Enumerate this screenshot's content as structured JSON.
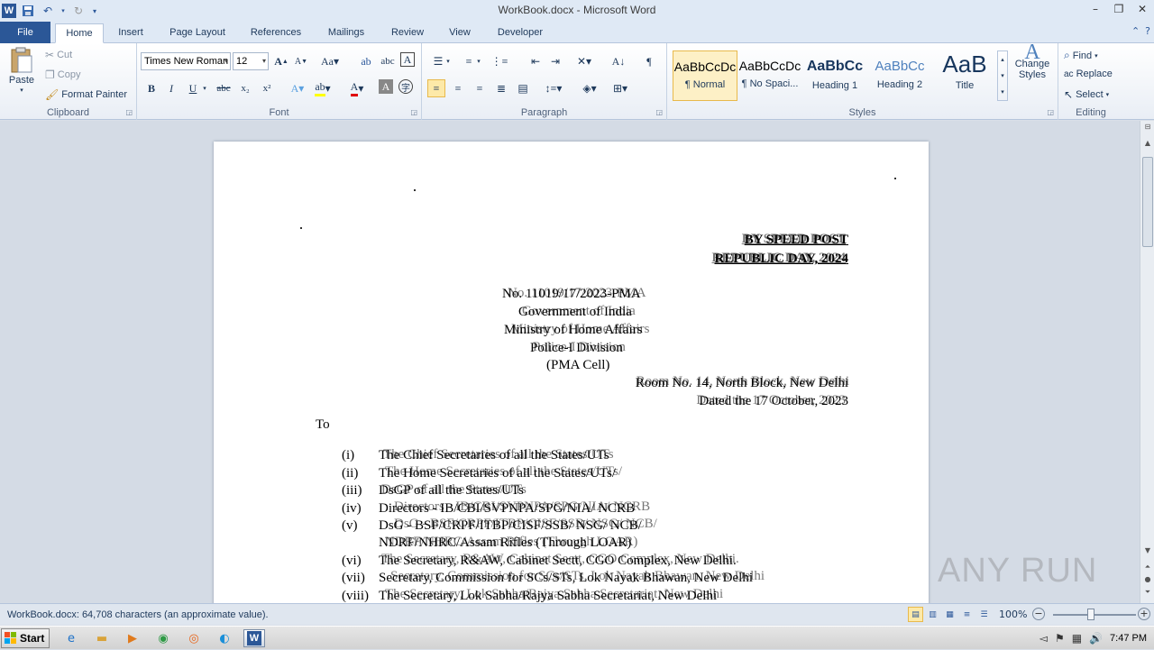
{
  "window": {
    "title": "WorkBook.docx - Microsoft Word",
    "controls": [
      "–",
      "❐",
      "✕"
    ]
  },
  "tabs": [
    {
      "label": "File"
    },
    {
      "label": "Home"
    },
    {
      "label": "Insert"
    },
    {
      "label": "Page Layout"
    },
    {
      "label": "References"
    },
    {
      "label": "Mailings"
    },
    {
      "label": "Review"
    },
    {
      "label": "View"
    },
    {
      "label": "Developer"
    }
  ],
  "ribbon": {
    "clipboard": {
      "label": "Clipboard",
      "paste": "Paste",
      "cut": "Cut",
      "copy": "Copy",
      "format_painter": "Format Painter"
    },
    "font": {
      "label": "Font",
      "font_name": "Times New Roman",
      "font_size": "12"
    },
    "paragraph": {
      "label": "Paragraph"
    },
    "styles": {
      "label": "Styles",
      "items": [
        {
          "sample": "AaBbCcDc",
          "name": "¶ Normal"
        },
        {
          "sample": "AaBbCcDc",
          "name": "¶ No Spaci..."
        },
        {
          "sample": "AaBbCc",
          "name": "Heading 1"
        },
        {
          "sample": "AaBbCc",
          "name": "Heading 2"
        },
        {
          "sample": "AaB",
          "name": "Title"
        }
      ],
      "change_styles": "Change Styles"
    },
    "editing": {
      "label": "Editing",
      "find": "Find",
      "replace": "Replace",
      "select": "Select"
    }
  },
  "document": {
    "header_lines": [
      "BY SPEED POST",
      "REPUBLIC   DAY, 2024"
    ],
    "center_lines": [
      "No. 11019/17/2023-PMA",
      "Government of India",
      "Ministry of Home Affairs",
      "Police-I Division",
      "(PMA Cell)"
    ],
    "room": "Room No. 14, North Block, New Delhi",
    "date": "Dated the 17 October, 2023",
    "to": "To",
    "list": [
      {
        "num": "(i)",
        "text": "The Chief Secretaries of all the States/UTs"
      },
      {
        "num": "(ii)",
        "text": "The Home Secretaries of all the States/UTs/"
      },
      {
        "num": "(iii)",
        "text": "DsGP of all the States/UTs"
      },
      {
        "num": "(iv)",
        "text": "Directors - IB/CBI/SVPNPA/SPG/NIA/ NCRB"
      },
      {
        "num": "(v)",
        "text": "DsG - BSF/CRPF/ITBP/CISF/SSB/ NSG/ NCB/"
      },
      {
        "num": "",
        "text": "NDRF/NHRC/Assam Rifles (Through LOAR)"
      },
      {
        "num": "(vi)",
        "text": "The Secretary, R&AW, Cabinet Sectt, CGO Complex, New Delhi."
      },
      {
        "num": "(vii)",
        "text": "Secretary, Commission for SCs/STs, Lok Nayak Bhawan, New Delhi"
      },
      {
        "num": "(viii)",
        "text": "The Secretary, Lok Sabha/Rajya Sabha Secretariat, New Delhi"
      }
    ]
  },
  "statusbar": {
    "text": "WorkBook.docx: 64,708 characters (an approximate value).",
    "zoom": "100%"
  },
  "watermark": "ANY RUN",
  "taskbar": {
    "start": "Start",
    "clock": "7:47 PM"
  },
  "colors": {
    "file_tab": "#2b5797",
    "ribbon_bg": "#ffffff",
    "doc_bg": "#d4dbe5"
  }
}
